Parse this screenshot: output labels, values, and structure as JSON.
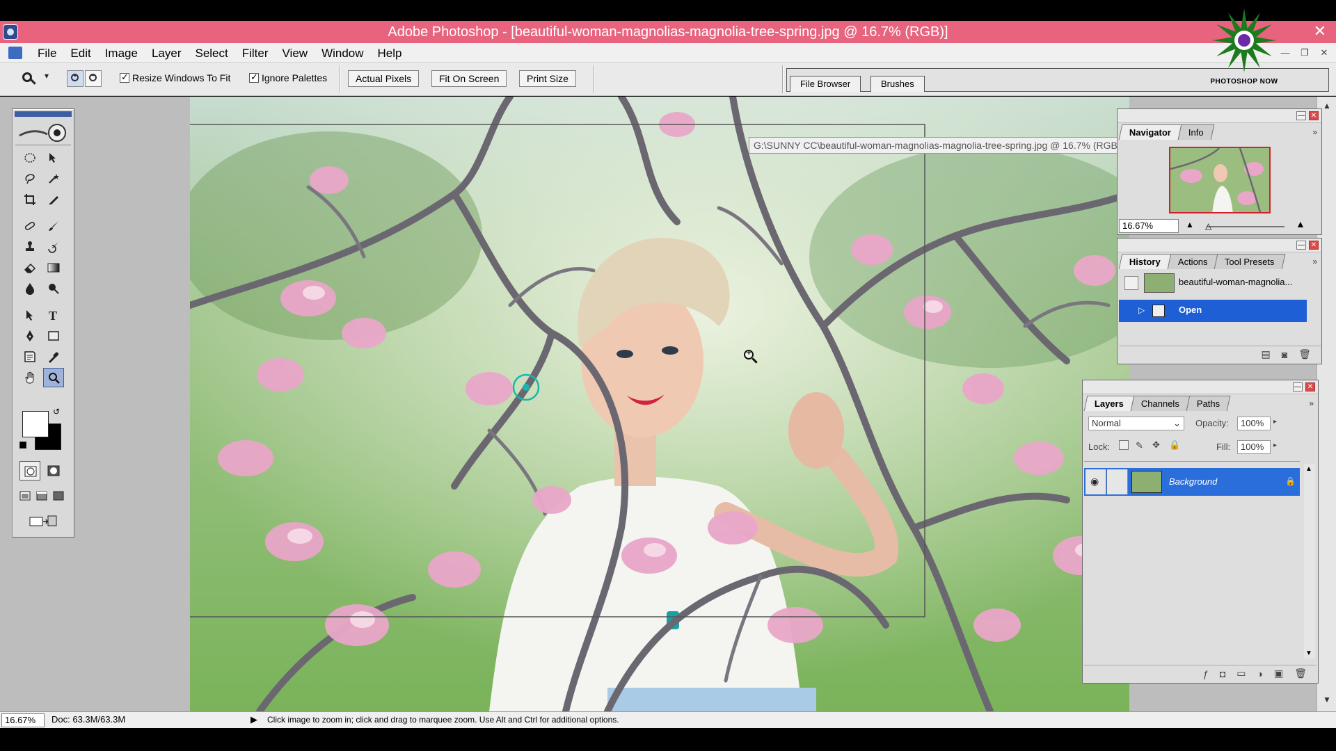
{
  "window": {
    "title": "Adobe Photoshop - [beautiful-woman-magnolias-magnolia-tree-spring.jpg @ 16.7% (RGB)]",
    "close_glyph": "✕"
  },
  "menu": {
    "items": [
      "File",
      "Edit",
      "Image",
      "Layer",
      "Select",
      "Filter",
      "View",
      "Window",
      "Help"
    ],
    "doc_controls": [
      "—",
      "❐",
      "✕"
    ]
  },
  "options_bar": {
    "tool_icon": "zoom-icon",
    "zoom_in_symbol": "+",
    "zoom_out_symbol": "−",
    "resize_windows_label": "Resize Windows To Fit",
    "resize_windows_checked": true,
    "ignore_palettes_label": "Ignore Palettes",
    "ignore_palettes_checked": true,
    "actual_pixels_label": "Actual Pixels",
    "fit_on_screen_label": "Fit On Screen",
    "print_size_label": "Print Size"
  },
  "palette_well": {
    "tabs": [
      "File Browser",
      "Brushes"
    ]
  },
  "logo": {
    "caption": "PHOTOSHOP NOW",
    "accent": "#1d7a1d"
  },
  "canvas": {
    "tooltip": "G:\\SUNNY CC\\beautiful-woman-magnolias-magnolia-tree-spring.jpg @ 16.7% (RGB)"
  },
  "toolbox": {
    "tools": [
      "elliptical-marquee-icon",
      "move-icon",
      "lasso-icon",
      "magic-wand-icon",
      "crop-icon",
      "slice-icon",
      "healing-brush-icon",
      "brush-icon",
      "clone-stamp-icon",
      "history-brush-icon",
      "eraser-icon",
      "gradient-icon",
      "blur-icon",
      "dodge-icon",
      "path-selection-icon",
      "type-icon",
      "pen-icon",
      "shape-icon",
      "notes-icon",
      "eyedropper-icon",
      "hand-icon",
      "zoom-icon"
    ],
    "active_tool": "zoom-icon",
    "foreground": "#ffffff",
    "background": "#000000"
  },
  "navigator": {
    "tabs": [
      "Navigator",
      "Info"
    ],
    "active_tab": "Navigator",
    "zoom_value": "16.67%",
    "view_box_color": "#d2202c"
  },
  "history": {
    "tabs": [
      "History",
      "Actions",
      "Tool Presets"
    ],
    "active_tab": "History",
    "snapshot_label": "beautiful-woman-magnolia...",
    "states": [
      {
        "label": "Open",
        "selected": true
      }
    ],
    "selection_color": "#1e5fd6"
  },
  "layers": {
    "tabs": [
      "Layers",
      "Channels",
      "Paths"
    ],
    "active_tab": "Layers",
    "blend_mode": "Normal",
    "opacity_label": "Opacity:",
    "opacity_value": "100%",
    "lock_label": "Lock:",
    "fill_label": "Fill:",
    "fill_value": "100%",
    "items": [
      {
        "name": "Background",
        "visible": true,
        "locked": true
      }
    ]
  },
  "status_bar": {
    "zoom_value": "16.67%",
    "doc_size": "Doc: 63.3M/63.3M",
    "hint": "Click image to zoom in; click and drag to marquee zoom.  Use Alt and Ctrl for additional options."
  }
}
